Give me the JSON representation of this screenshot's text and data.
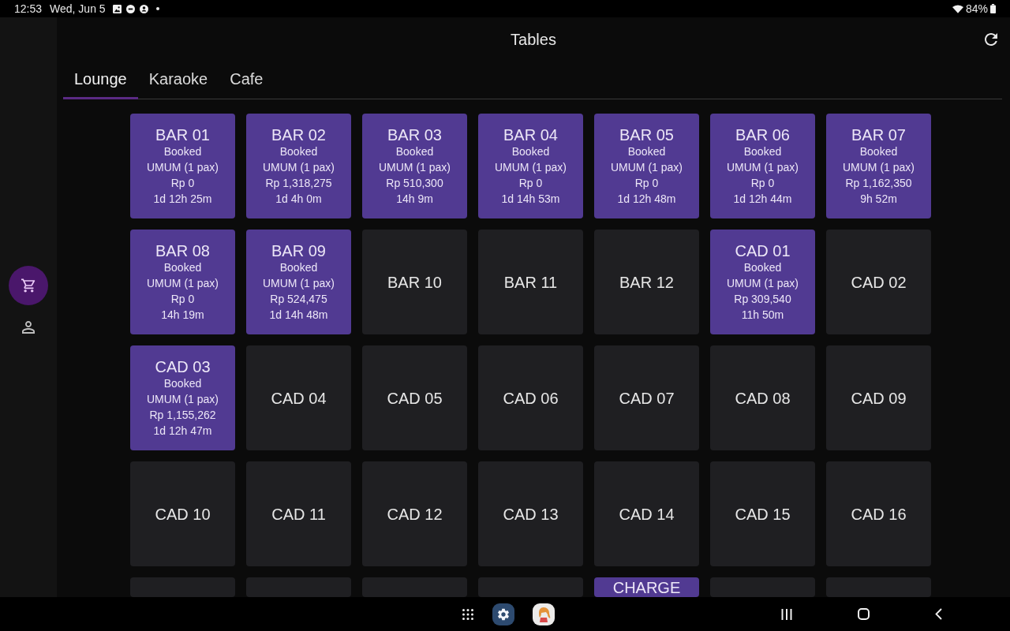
{
  "status_bar": {
    "time": "12:53",
    "date": "Wed, Jun 5",
    "battery": "84%"
  },
  "sidebar": {
    "items": [
      {
        "kind": "cart",
        "selected": true
      },
      {
        "kind": "person",
        "selected": false
      }
    ]
  },
  "app_bar": {
    "title": "Tables"
  },
  "tabs": [
    {
      "label": "Lounge",
      "selected": true
    },
    {
      "label": "Karaoke",
      "selected": false
    },
    {
      "label": "Cafe",
      "selected": false
    }
  ],
  "tables": [
    {
      "name": "BAR 01",
      "occupied": true,
      "status": "Booked",
      "guest": "UMUM (1 pax)",
      "amount": "Rp 0",
      "elapsed": "1d 12h 25m"
    },
    {
      "name": "BAR 02",
      "occupied": true,
      "status": "Booked",
      "guest": "UMUM (1 pax)",
      "amount": "Rp 1,318,275",
      "elapsed": "1d 4h 0m"
    },
    {
      "name": "BAR 03",
      "occupied": true,
      "status": "Booked",
      "guest": "UMUM (1 pax)",
      "amount": "Rp 510,300",
      "elapsed": "14h 9m"
    },
    {
      "name": "BAR 04",
      "occupied": true,
      "status": "Booked",
      "guest": "UMUM (1 pax)",
      "amount": "Rp 0",
      "elapsed": "1d 14h 53m"
    },
    {
      "name": "BAR 05",
      "occupied": true,
      "status": "Booked",
      "guest": "UMUM (1 pax)",
      "amount": "Rp 0",
      "elapsed": "1d 12h 48m"
    },
    {
      "name": "BAR 06",
      "occupied": true,
      "status": "Booked",
      "guest": "UMUM (1 pax)",
      "amount": "Rp 0",
      "elapsed": "1d 12h 44m"
    },
    {
      "name": "BAR 07",
      "occupied": true,
      "status": "Booked",
      "guest": "UMUM (1 pax)",
      "amount": "Rp 1,162,350",
      "elapsed": "9h 52m"
    },
    {
      "name": "BAR 08",
      "occupied": true,
      "status": "Booked",
      "guest": "UMUM (1 pax)",
      "amount": "Rp 0",
      "elapsed": "14h 19m"
    },
    {
      "name": "BAR 09",
      "occupied": true,
      "status": "Booked",
      "guest": "UMUM (1 pax)",
      "amount": "Rp 524,475",
      "elapsed": "1d 14h 48m"
    },
    {
      "name": "BAR 10",
      "occupied": false
    },
    {
      "name": "BAR 11",
      "occupied": false
    },
    {
      "name": "BAR 12",
      "occupied": false
    },
    {
      "name": "CAD 01",
      "occupied": true,
      "status": "Booked",
      "guest": "UMUM (1 pax)",
      "amount": "Rp 309,540",
      "elapsed": "11h 50m"
    },
    {
      "name": "CAD 02",
      "occupied": false
    },
    {
      "name": "CAD 03",
      "occupied": true,
      "status": "Booked",
      "guest": "UMUM (1 pax)",
      "amount": "Rp 1,155,262",
      "elapsed": "1d 12h 47m"
    },
    {
      "name": "CAD 04",
      "occupied": false
    },
    {
      "name": "CAD 05",
      "occupied": false
    },
    {
      "name": "CAD 06",
      "occupied": false
    },
    {
      "name": "CAD 07",
      "occupied": false
    },
    {
      "name": "CAD 08",
      "occupied": false
    },
    {
      "name": "CAD 09",
      "occupied": false
    },
    {
      "name": "CAD 10",
      "occupied": false
    },
    {
      "name": "CAD 11",
      "occupied": false
    },
    {
      "name": "CAD 12",
      "occupied": false
    },
    {
      "name": "CAD 13",
      "occupied": false
    },
    {
      "name": "CAD 14",
      "occupied": false
    },
    {
      "name": "CAD 15",
      "occupied": false
    },
    {
      "name": "CAD 16",
      "occupied": false
    },
    {
      "occupied": false
    },
    {
      "occupied": false
    },
    {
      "occupied": false
    },
    {
      "occupied": false
    },
    {
      "name": "CHARGE",
      "occupied": true
    },
    {
      "occupied": false
    },
    {
      "occupied": false
    }
  ]
}
